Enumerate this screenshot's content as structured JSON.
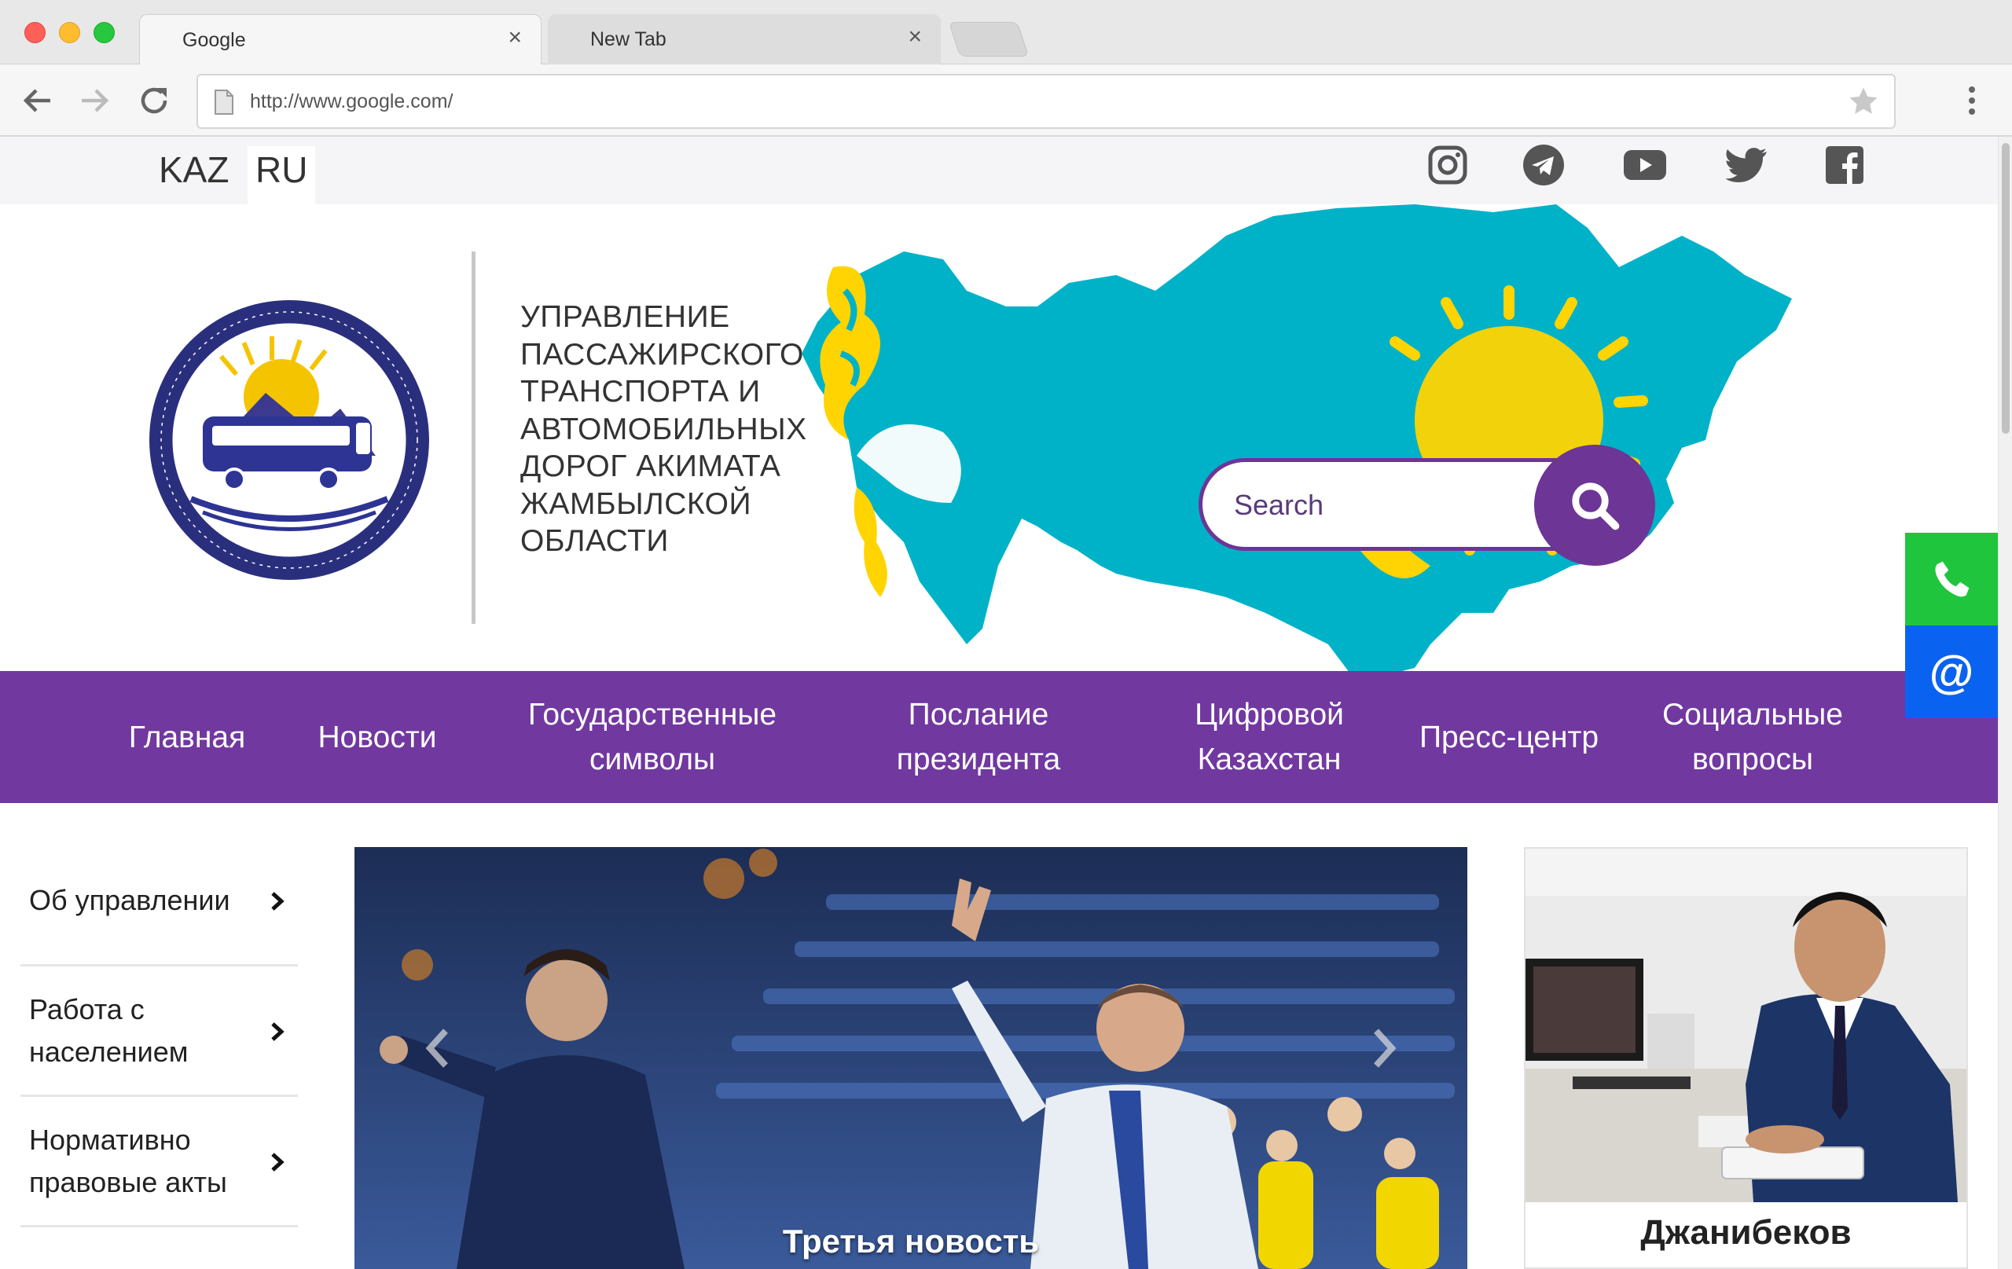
{
  "browser": {
    "tabs": [
      {
        "title": "Google",
        "close": "×"
      },
      {
        "title": "New Tab",
        "close": "×"
      }
    ],
    "url": "http://www.google.com/"
  },
  "topbar": {
    "languages": [
      "KAZ",
      "RU"
    ],
    "selected_language": "RU",
    "social_icons": [
      "instagram-icon",
      "telegram-icon",
      "youtube-icon",
      "twitter-icon",
      "facebook-icon"
    ]
  },
  "header": {
    "org_name_lines": [
      "УПРАВЛЕНИЕ",
      "ПАССАЖИРСКОГО",
      "ТРАНСПОРТА И",
      "АВТОМОБИЛЬНЫХ",
      "ДОРОГ АКИМАТА",
      "ЖАМБЫЛСКОЙ",
      "ОБЛАСТИ"
    ],
    "search_placeholder": "Search"
  },
  "nav": {
    "items": [
      {
        "label": "Главная"
      },
      {
        "label": "Новости"
      },
      {
        "label": "Государственные символы"
      },
      {
        "label": "Послание президента"
      },
      {
        "label": "Цифровой Казахстан"
      },
      {
        "label": "Пресс-центр"
      },
      {
        "label": "Социальные вопросы"
      }
    ]
  },
  "contact_buttons": {
    "mail_symbol": "@"
  },
  "sidebar": {
    "items": [
      {
        "label": "Об управлении"
      },
      {
        "label": "Работа с населением"
      },
      {
        "label": "Нормативно правовые акты"
      }
    ]
  },
  "slider": {
    "caption": "Третья новость"
  },
  "person": {
    "name": "Джанибеков"
  },
  "colors": {
    "brand_purple": "#7138a0",
    "map_blue": "#00b2c8",
    "sun_yellow": "#ffd400",
    "phone_green": "#1fc53d",
    "mail_blue": "#0a63f0"
  }
}
